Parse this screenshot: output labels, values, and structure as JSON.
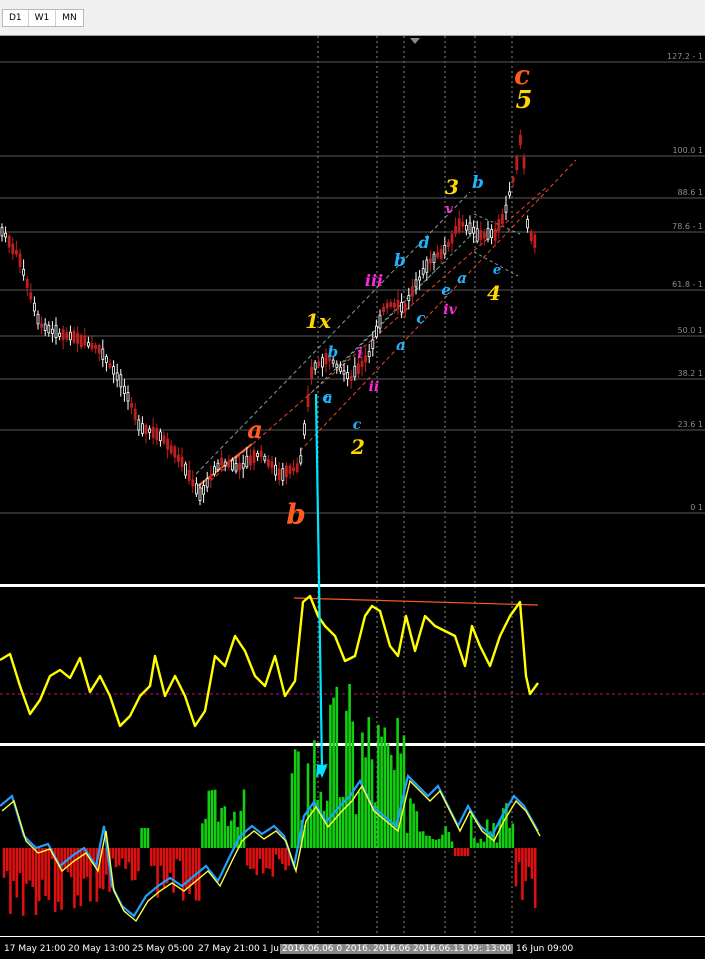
{
  "tabs": [
    "D1",
    "W1",
    "MN"
  ],
  "fib_levels": [
    {
      "label": "127.2 - 1",
      "key": "127.2"
    },
    {
      "label": "100.0 1",
      "key": "100.0"
    },
    {
      "label": "88.6 1",
      "key": "88.6"
    },
    {
      "label": "78.6 - 1",
      "key": "78.6"
    },
    {
      "label": "61.8 - 1",
      "key": "61.8"
    },
    {
      "label": "50.0 1",
      "key": "50.0"
    },
    {
      "label": "38.2 1",
      "key": "38.2"
    },
    {
      "label": "23.6 1",
      "key": "23.6"
    },
    {
      "label": "0 1",
      "key": "0"
    }
  ],
  "wave_labels": [
    {
      "text": "c",
      "color": "#ff5a1f",
      "size": 26
    },
    {
      "text": "5",
      "color": "#ffd700",
      "size": 24
    },
    {
      "text": "3",
      "color": "#ffd700",
      "size": 20
    },
    {
      "text": "b",
      "color": "#1fb4ff",
      "size": 17
    },
    {
      "text": "v",
      "color": "#ff2bd6",
      "size": 13
    },
    {
      "text": "d",
      "color": "#1fb4ff",
      "size": 16
    },
    {
      "text": "b",
      "color": "#1fb4ff",
      "size": 17
    },
    {
      "text": "iii",
      "color": "#ff2bd6",
      "size": 16
    },
    {
      "text": "a",
      "color": "#1fb4ff",
      "size": 15
    },
    {
      "text": "e",
      "color": "#1fb4ff",
      "size": 15
    },
    {
      "text": "4",
      "color": "#ffd700",
      "size": 20
    },
    {
      "text": "c",
      "color": "#1fb4ff",
      "size": 15
    },
    {
      "text": "iv",
      "color": "#ff2bd6",
      "size": 14
    },
    {
      "text": "e",
      "color": "#1fb4ff",
      "size": 13
    },
    {
      "text": "1x",
      "color": "#ffd700",
      "size": 20
    },
    {
      "text": "b",
      "color": "#1fb4ff",
      "size": 15
    },
    {
      "text": "i",
      "color": "#ff2bd6",
      "size": 15
    },
    {
      "text": "a",
      "color": "#1fb4ff",
      "size": 15
    },
    {
      "text": "c",
      "color": "#1fb4ff",
      "size": 15
    },
    {
      "text": "a",
      "color": "#1fb4ff",
      "size": 14
    },
    {
      "text": "ii",
      "color": "#ff2bd6",
      "size": 14
    },
    {
      "text": "c",
      "color": "#1fb4ff",
      "size": 14
    },
    {
      "text": "2",
      "color": "#ffd700",
      "size": 20
    },
    {
      "text": "a",
      "color": "#ff5a1f",
      "size": 24
    },
    {
      "text": "b",
      "color": "#ff5a1f",
      "size": 28
    }
  ],
  "time_labels": [
    {
      "text": "17 May 21:00",
      "hi": false
    },
    {
      "text": "20 May 13:00",
      "hi": false
    },
    {
      "text": "25 May 05:00",
      "hi": false
    },
    {
      "text": "27 May 21:00",
      "hi": false
    },
    {
      "text": "1 Ju",
      "hi": false
    },
    {
      "text": "2016.06.06 0:",
      "hi": true
    },
    {
      "text": "2016.",
      "hi": true
    },
    {
      "text": "2016.06.",
      "hi": true
    },
    {
      "text": "2016.06.13 09:55",
      "hi": true
    },
    {
      "text": "13:00",
      "hi": true
    },
    {
      "text": "16 Jun 09:00",
      "hi": false
    }
  ],
  "colors": {
    "background": "#000000",
    "bull": "#ffffff",
    "bear": "#c02020",
    "fib_line": "#5a5a5a",
    "channel": "#e84a2a",
    "oscillator": "#ffff00",
    "hist_up": "#10d010",
    "hist_down": "#e01010",
    "arrow": "#00e5ff",
    "signal_blue": "#1fa0ff"
  },
  "icons": {
    "scroll_marker": "triangle-down"
  }
}
